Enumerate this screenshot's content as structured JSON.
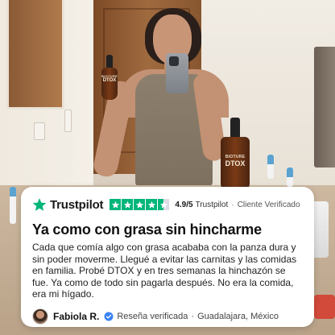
{
  "product": {
    "brand": "BIOTURE",
    "name": "DTOX"
  },
  "review": {
    "platform": "Trustpilot",
    "rating": 4.5,
    "score_text": "4.9/5",
    "score_suffix": "Trustpilot",
    "separator": "·",
    "verified_label": "Cliente Verificado",
    "headline": "Ya como con grasa sin hincharme",
    "body": "Cada que comía algo con grasa acababa con la panza dura y sin poder moverme. Llegué a evitar las carnitas y las comidas en familia. Probé DTOX y en tres semanas la hinchazón se fue. Ya como de todo sin pagarla después. No era la comida, era mi hígado.",
    "author": {
      "name": "Fabiola R.",
      "verification": "Reseña verificada",
      "separator": "·",
      "location": "Guadalajara, México"
    }
  },
  "colors": {
    "trustpilot_green": "#00b67a",
    "verified_blue": "#3b82f6",
    "card_bg": "#ffffff"
  },
  "icons": {
    "trustpilot_logo": "star-icon",
    "rating_star": "star-icon",
    "verified": "check-badge-icon"
  }
}
